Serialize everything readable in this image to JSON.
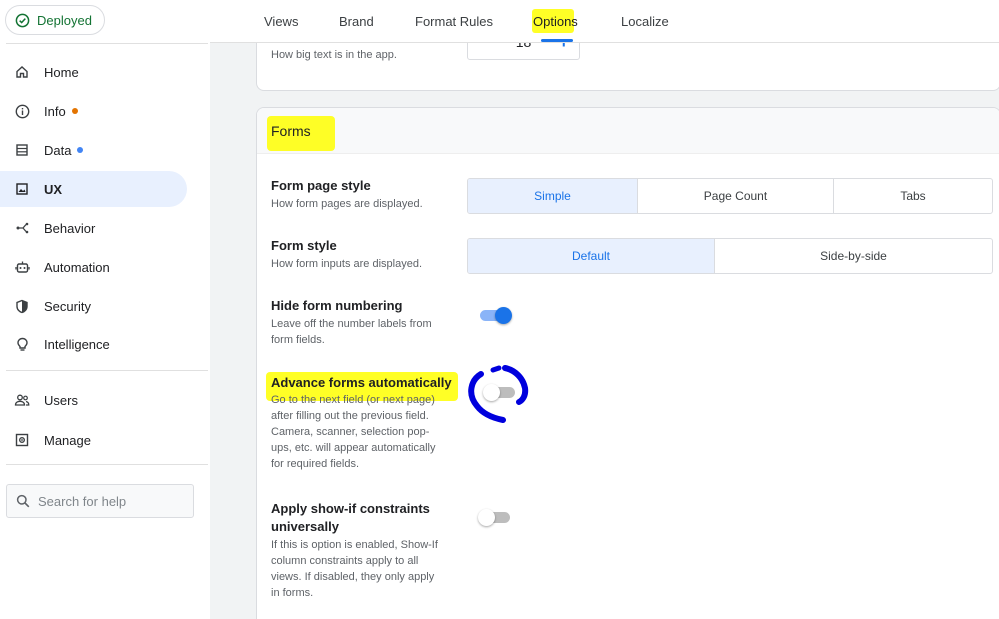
{
  "status": {
    "label": "Deployed",
    "color": "#137333"
  },
  "sidebar": {
    "items": [
      {
        "label": "Home",
        "icon": "home-icon"
      },
      {
        "label": "Info",
        "icon": "info-icon",
        "dot": "#e37400"
      },
      {
        "label": "Data",
        "icon": "data-icon",
        "dot": "#4285f4"
      },
      {
        "label": "UX",
        "icon": "ux-icon",
        "active": true
      },
      {
        "label": "Behavior",
        "icon": "behavior-icon"
      },
      {
        "label": "Automation",
        "icon": "automation-icon"
      },
      {
        "label": "Security",
        "icon": "shield-icon"
      },
      {
        "label": "Intelligence",
        "icon": "lightbulb-icon"
      },
      {
        "label": "Users",
        "icon": "users-icon"
      },
      {
        "label": "Manage",
        "icon": "manage-icon"
      }
    ],
    "search_placeholder": "Search for help"
  },
  "tabs": [
    {
      "label": "Views"
    },
    {
      "label": "Brand"
    },
    {
      "label": "Format Rules"
    },
    {
      "label": "Options",
      "active": true
    },
    {
      "label": "Localize"
    }
  ],
  "text_size": {
    "description": "How big text is in the app.",
    "value": "18",
    "minus": "−",
    "plus": "+"
  },
  "forms": {
    "title": "Forms",
    "form_page_style": {
      "title": "Form page style",
      "description": "How form pages are displayed.",
      "options": [
        "Simple",
        "Page Count",
        "Tabs"
      ],
      "selected": "Simple"
    },
    "form_style": {
      "title": "Form style",
      "description": "How form inputs are displayed.",
      "options": [
        "Default",
        "Side-by-side"
      ],
      "selected": "Default"
    },
    "hide_form_numbering": {
      "title": "Hide form numbering",
      "description_lines": [
        "Leave off the number labels from",
        "form fields."
      ],
      "enabled": true
    },
    "advance_forms_automatically": {
      "title": "Advance forms automatically",
      "description_lines": [
        "Go to the next field (or next page)",
        "after filling out the previous field.",
        "Camera, scanner, selection pop-",
        "ups, etc. will appear automatically",
        "for required fields."
      ],
      "enabled": false
    },
    "apply_show_if": {
      "title_lines": [
        "Apply show-if constraints",
        "universally"
      ],
      "description_lines": [
        "If this is option is enabled, Show-If",
        "column constraints apply to all",
        "views. If disabled, they only apply",
        "in forms."
      ],
      "enabled": false
    }
  },
  "colors": {
    "accent": "#1a73e8",
    "highlight": "#ffff00",
    "annotation": "#0000dd"
  }
}
